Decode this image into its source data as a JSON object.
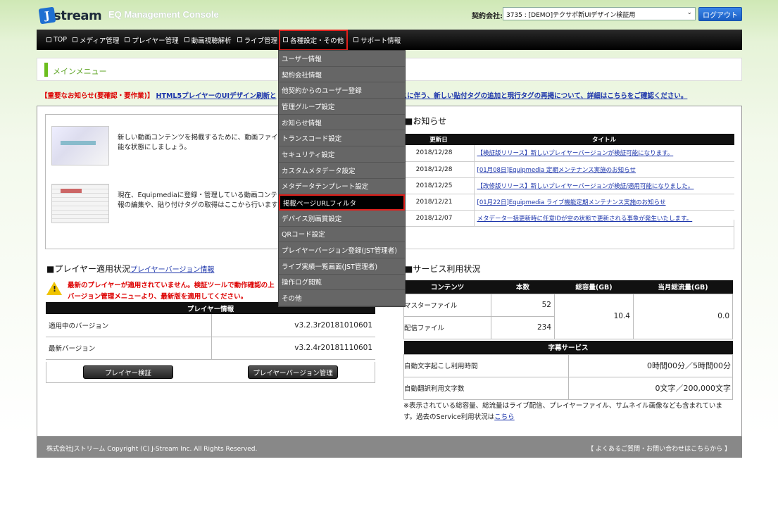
{
  "header": {
    "logo_text": "stream",
    "logo_mark": "J",
    "app_title": "EQ Management Console",
    "contract_label": "契約会社:",
    "contract_value": "3735 : [DEMO]テクサポ新UIデザイン検証用",
    "logout": "ログアウト"
  },
  "nav": [
    {
      "label": "TOP"
    },
    {
      "label": "メディア管理"
    },
    {
      "label": "プレイヤー管理"
    },
    {
      "label": "動画視聴解析"
    },
    {
      "label": "ライブ管理"
    },
    {
      "label": "各種設定・その他"
    },
    {
      "label": "サポート情報"
    }
  ],
  "page_title": "メインメニュー",
  "notice_line": {
    "urgent": "【重要なお知らせ(要確認・要作業)】",
    "link_start": "HTML5プレイヤーのUIデザイン刷新と",
    "link_end": "スに伴う、新しい貼付タグの追加と現行タグの再掲について、詳細はこちらをご確認ください。"
  },
  "menu": {
    "entry1": "新しい動画コンテンツを掲載するために、動画ファイル",
    "entry1b": "能な状態にしましょう。",
    "entry2": "現在、Equipmediaに登録・管理している動画コンテン",
    "entry2b": "報の編集や、貼り付けタグの取得はここから行います"
  },
  "news": {
    "title": "■お知らせ",
    "col_date": "更新日",
    "col_title": "タイトル",
    "rows": [
      {
        "date": "2018/12/28",
        "title": "【検証版リリース】新しいプレイヤーバージョンが検証可能になります。"
      },
      {
        "date": "2018/12/28",
        "title": "[01月08日]Equipmedia 定期メンテナンス実施のお知らせ"
      },
      {
        "date": "2018/12/25",
        "title": "【改修版リリース】新しいプレイヤーバージョンが検証/適用可能になりました。"
      },
      {
        "date": "2018/12/21",
        "title": "[01月22日]Equipmedia ライブ機能定期メンテナンス実施のお知らせ"
      },
      {
        "date": "2018/12/07",
        "title": "メタデータ一括更新時に任意IDが空の状態で更新される事象が発生いたします。"
      }
    ]
  },
  "player": {
    "title": "■プレイヤー適用状況",
    "title_link": "プレイヤーバージョン情報",
    "warning_line1": "最新のプレイヤーが適用されていません。検証ツールで動作確認の上",
    "warning_line2": "バージョン管理メニューより、最新版を適用してください。",
    "table_header": "プレイヤー情報",
    "current_label": "適用中のバージョン",
    "current_value": "v3.2.3r20181010601",
    "latest_label": "最新バージョン",
    "latest_value": "v3.2.4r20181110601",
    "btn_verify": "プレイヤー検証",
    "btn_manage": "プレイヤーバージョン管理"
  },
  "service": {
    "title": "■サービス利用状況",
    "cols": [
      "コンテンツ",
      "本数",
      "総容量(GB)",
      "当月総流量(GB)"
    ],
    "master_label": "マスターファイル",
    "master_count": "52",
    "delivery_label": "配信ファイル",
    "delivery_count": "234",
    "total_size": "10.4",
    "monthly_flow": "0.0",
    "caption_header": "字幕サービス",
    "auto_transcribe_label": "自動文字起こし利用時間",
    "auto_transcribe_value": "0時間00分／5時間00分",
    "auto_translate_label": "自動翻訳利用文字数",
    "auto_translate_value": "0文字／200,000文字",
    "note": "※表示されている総容量、総流量はライブ配信、プレイヤーファイル、サムネイル画像なども含まれています。過去のService利用状況は",
    "note_link": "こちら"
  },
  "dropdown": [
    "ユーザー情報",
    "契約会社情報",
    "他契約からのユーザー登録",
    "管理グループ設定",
    "お知らせ情報",
    "トランスコード設定",
    "セキュリティ設定",
    "カスタムメタデータ設定",
    "メタデータテンプレート設定",
    "掲載ページURLフィルタ",
    "デバイス別画質設定",
    "QRコード設定",
    "プレイヤーバージョン登録(JST管理者)",
    "ライブ実績一覧画面(JST管理者)",
    "操作ログ閲覧",
    "その他"
  ],
  "footer": {
    "copyright": "株式会社Jストリーム Copyright (C) J-Stream Inc. All Rights Reserved.",
    "faq": "【 よくあるご質問・お問い合わせはこちらから 】"
  }
}
